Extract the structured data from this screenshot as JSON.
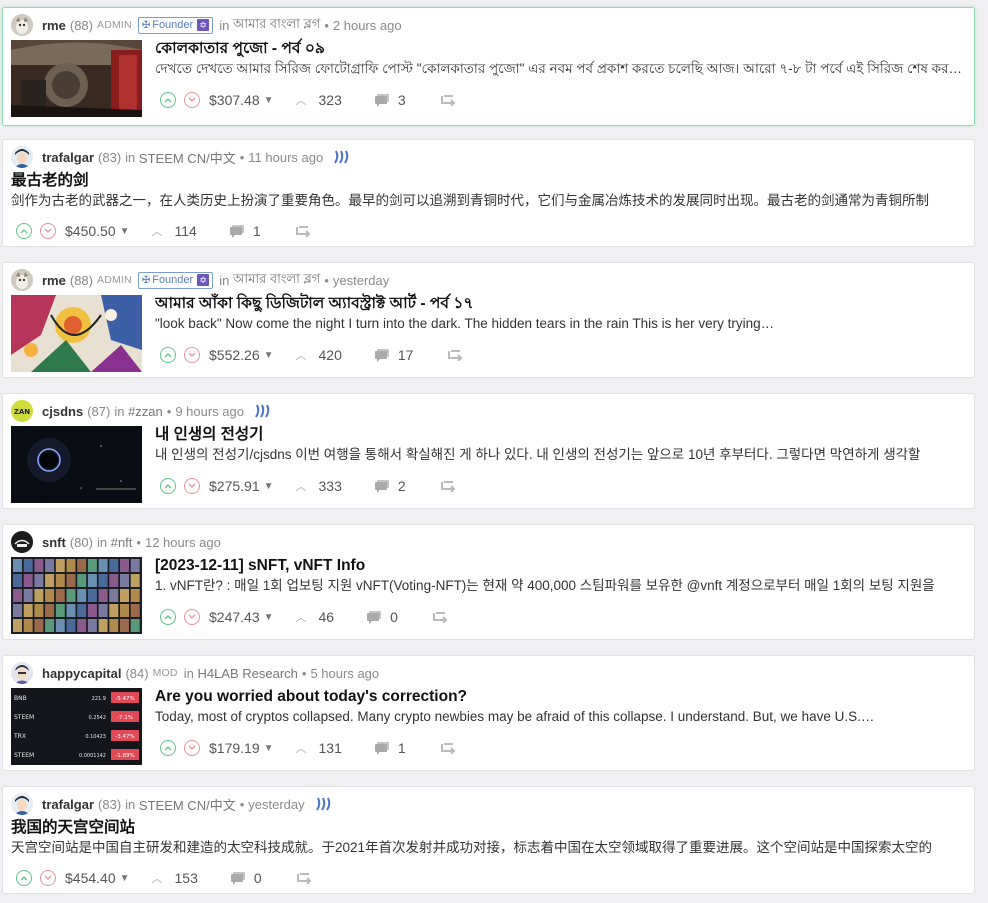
{
  "posts": [
    {
      "author": "rme",
      "reputation": "(88)",
      "role": "ADMIN",
      "badge": "Founder",
      "badge_icon": "✡",
      "in_label": "in",
      "community": "আমার বাংলা ব্লগ",
      "time": "2 hours ago",
      "title": "কোলকাতার পুজো - পর্ব ০৯",
      "summary": "দেখতে দেখতে আমার সিরিজ ফোটোগ্রাফি পোস্ট \"কোলকাতার পুজো\" এর নবম পর্ব প্রকাশ করতে চলেছি আজ। আরো ৭-৮ টা পর্বে এই সিরিজ শেষ করবো",
      "payout": "$307.48",
      "votes": "323",
      "comments": "3",
      "avatar_icon": "rme-avatar",
      "thumb_icon": "pandal-photo-thumbnail"
    },
    {
      "author": "trafalgar",
      "reputation": "(83)",
      "role": "",
      "badge": "",
      "badge_icon": "",
      "in_label": "in",
      "community": "STEEM CN/中文",
      "time": "11 hours ago",
      "title": "最古老的剑",
      "summary": "剑作为古老的武器之一，在人类历史上扮演了重要角色。最早的剑可以追溯到青铜时代，它们与金属冶炼技术的发展同时出现。最古老的剑通常为青铜所制",
      "payout": "$450.50",
      "votes": "114",
      "comments": "1",
      "avatar_icon": "trafalgar-avatar",
      "thumb_icon": ""
    },
    {
      "author": "rme",
      "reputation": "(88)",
      "role": "ADMIN",
      "badge": "Founder",
      "badge_icon": "✡",
      "in_label": "in",
      "community": "আমার বাংলা ব্লগ",
      "time": "yesterday",
      "title": "আমার আঁকা কিছু ডিজিটাল অ্যাবস্ট্রাক্ট আর্ট - পর্ব ১৭",
      "summary": "\"look back\" Now come the night I turn into the dark. The hidden tears in the rain This is her very trying…",
      "payout": "$552.26",
      "votes": "420",
      "comments": "17",
      "avatar_icon": "rme-avatar",
      "thumb_icon": "abstract-art-thumbnail"
    },
    {
      "author": "cjsdns",
      "reputation": "(87)",
      "role": "",
      "badge": "",
      "badge_icon": "",
      "in_label": "in",
      "community": "#zzan",
      "time": "9 hours ago",
      "title": "내 인생의 전성기",
      "summary": "내 인생의 전성기/cjsdns 이번 여행을 통해서 확실해진 게 하나 있다. 내 인생의 전성기는 앞으로 10년 후부터다. 그렇다면 막연하게 생각할",
      "payout": "$275.91",
      "votes": "333",
      "comments": "2",
      "avatar_icon": "cjsdns-avatar",
      "thumb_icon": "dark-ring-thumbnail"
    },
    {
      "author": "snft",
      "reputation": "(80)",
      "role": "",
      "badge": "",
      "badge_icon": "",
      "in_label": "in",
      "community": "#nft",
      "time": "12 hours ago",
      "title": "[2023-12-11] sNFT, vNFT Info",
      "summary": "1. vNFT란? : 매일 1회 업보팅 지원 vNFT(Voting-NFT)는 현재 약 400,000 스팀파워를 보유한 @vnft 계정으로부터 매일 1회의 보팅 지원을",
      "payout": "$247.43",
      "votes": "46",
      "comments": "0",
      "avatar_icon": "snft-avatar",
      "thumb_icon": "nft-grid-thumbnail"
    },
    {
      "author": "happycapital",
      "reputation": "(84)",
      "role": "MOD",
      "badge": "",
      "badge_icon": "",
      "in_label": "in",
      "community": "H4LAB Research",
      "time": "5 hours ago",
      "title": "Are you worried about today's correction?",
      "summary": "Today, most of cryptos collapsed. Many crypto newbies may be afraid of this collapse. I understand. But, we have U.S.…",
      "payout": "$179.19",
      "votes": "131",
      "comments": "1",
      "avatar_icon": "happycapital-avatar",
      "thumb_icon": "crypto-prices-thumbnail"
    },
    {
      "author": "trafalgar",
      "reputation": "(83)",
      "role": "",
      "badge": "",
      "badge_icon": "",
      "in_label": "in",
      "community": "STEEM CN/中文",
      "time": "yesterday",
      "title": "我国的天宫空间站",
      "summary": "天宫空间站是中国自主研发和建造的太空科技成就。于2021年首次发射并成功对接，标志着中国在太空领域取得了重要进展。这个空间站是中国探索太空的",
      "payout": "$454.40",
      "votes": "153",
      "comments": "0",
      "avatar_icon": "trafalgar-avatar",
      "thumb_icon": ""
    }
  ],
  "crypto_rows": [
    {
      "sym": "BNB",
      "price": "221.9",
      "chg": "-5.47%"
    },
    {
      "sym": "STEEM",
      "price": "0.2542",
      "chg": "-7.1%"
    },
    {
      "sym": "TRX",
      "price": "0.10423",
      "chg": "-3.47%"
    },
    {
      "sym": "STEEM",
      "price": "0.0001142",
      "chg": "-1.89%"
    }
  ],
  "colors": {
    "accent_green": "#5ec48b",
    "downvote_red": "#e8939a",
    "highlight_border": "#8fdcb4",
    "steem_blue": "#4a72c8"
  }
}
